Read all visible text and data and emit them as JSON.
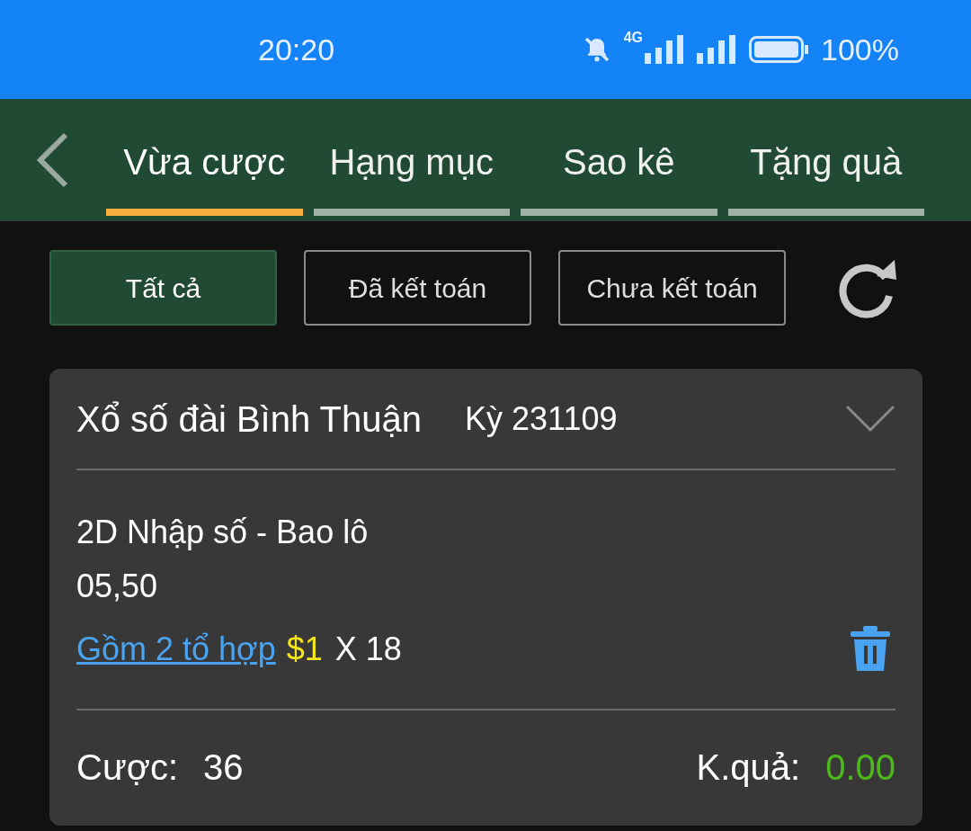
{
  "status_bar": {
    "time": "20:20",
    "network": "4G",
    "battery": "100%"
  },
  "tabs": [
    {
      "label": "Vừa cược",
      "selected": true
    },
    {
      "label": "Hạng mục",
      "selected": false
    },
    {
      "label": "Sao kê",
      "selected": false
    },
    {
      "label": "Tặng quà",
      "selected": false
    }
  ],
  "filters": [
    {
      "label": "Tất cả",
      "selected": true
    },
    {
      "label": "Đã kết toán",
      "selected": false
    },
    {
      "label": "Chưa kết toán",
      "selected": false
    }
  ],
  "bet_card": {
    "title": "Xổ số đài Bình Thuận",
    "period": "Kỳ 231109",
    "expanded": false,
    "bet_type": "2D Nhập số - Bao lô",
    "numbers": "05,50",
    "combo_link": "Gồm 2 tổ hợp",
    "unit": "$1",
    "multiplier": "X 18",
    "stake_label": "Cược:",
    "stake": "36",
    "result_label": "K.quả:",
    "result": "0.00"
  }
}
